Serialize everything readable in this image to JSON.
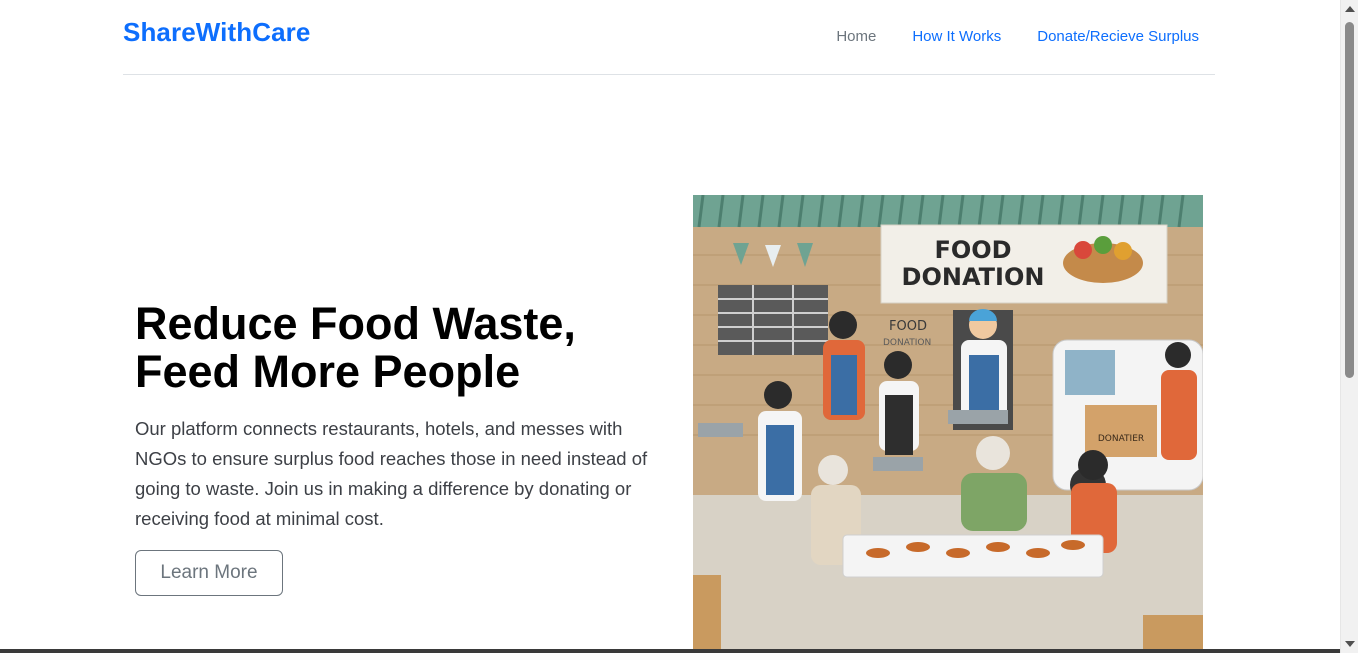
{
  "nav": {
    "brand": "ShareWithCare",
    "links": [
      {
        "label": "Home",
        "active": false
      },
      {
        "label": "How It Works",
        "active": true
      },
      {
        "label": "Donate/Recieve Surplus",
        "active": true
      }
    ]
  },
  "hero": {
    "title_line1": "Reduce Food Waste,",
    "title_line2": "Feed More People",
    "body": "Our platform connects restaurants, hotels, and messes with NGOs to ensure surplus food reaches those in need instead of going to waste. Join us in making a difference by donating or receiving food at minimal cost.",
    "button_label": "Learn More",
    "image": {
      "banner_line1": "FOOD",
      "banner_line2": "DONATION",
      "wall_sign_line1": "FOOD",
      "wall_sign_line2": "DONATION",
      "box_label": "DONATIER"
    }
  },
  "colors": {
    "brand": "#0d6efd",
    "muted": "#6c757d",
    "title": "#000000"
  },
  "icons": [
    "scroll-up-arrow-icon",
    "scroll-down-arrow-icon"
  ]
}
